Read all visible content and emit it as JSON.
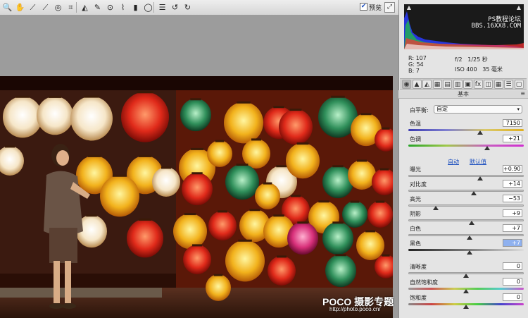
{
  "toolbar": {
    "tools": [
      {
        "name": "zoom-tool-icon",
        "glyph": "🔍"
      },
      {
        "name": "hand-tool-icon",
        "glyph": "✋"
      },
      {
        "name": "white-balance-tool-icon",
        "glyph": "⟋"
      },
      {
        "name": "color-sampler-icon",
        "glyph": "⟋"
      },
      {
        "name": "targeted-adjust-icon",
        "glyph": "◎"
      },
      {
        "name": "crop-tool-icon",
        "glyph": "⌗"
      },
      {
        "name": "straighten-tool-icon",
        "glyph": "◭"
      },
      {
        "name": "spot-removal-icon",
        "glyph": "✎"
      },
      {
        "name": "red-eye-icon",
        "glyph": "⊙"
      },
      {
        "name": "adjustment-brush-icon",
        "glyph": "⌇"
      },
      {
        "name": "graduated-filter-icon",
        "glyph": "▮"
      },
      {
        "name": "radial-filter-icon",
        "glyph": "◯"
      },
      {
        "name": "preferences-icon",
        "glyph": "☰"
      },
      {
        "name": "rotate-ccw-icon",
        "glyph": "↺"
      },
      {
        "name": "rotate-cw-icon",
        "glyph": "↻"
      }
    ],
    "preview_checked": "✔",
    "preview_label": "预览",
    "fullscreen_glyph": "⤢"
  },
  "watermark": {
    "brand": "POCO 摄影专题",
    "url": "http://photo.poco.cn/"
  },
  "histogram": {
    "watermark_line1": "PS教程论坛",
    "watermark_line2": "BBS.16XX8.COM"
  },
  "readout": {
    "r_label": "R:",
    "r_value": "107",
    "g_label": "G:",
    "g_value": "54",
    "b_label": "B:",
    "b_value": "7",
    "aperture": "f/2",
    "shutter": "1/25 秒",
    "iso": "ISO 400",
    "focal": "35 毫米"
  },
  "panel_tabs": [
    "◉",
    "▲",
    "◭",
    "▦",
    "▤",
    "▥",
    "▣",
    "fx",
    "◫",
    "▦",
    "☰",
    "▢"
  ],
  "section": {
    "title": "基本",
    "menu_glyph": "≡"
  },
  "white_balance": {
    "label": "白平衡:",
    "value": "自定",
    "chevron": "▾"
  },
  "auto_link": "自动",
  "default_link": "默认值",
  "sliders": {
    "temperature": {
      "label": "色温",
      "value": "7150",
      "level": 0.62
    },
    "tint": {
      "label": "色调",
      "value": "+21",
      "level": 0.68
    },
    "exposure": {
      "label": "曝光",
      "value": "+0.90",
      "level": 0.62
    },
    "contrast": {
      "label": "对比度",
      "value": "+14",
      "level": 0.57
    },
    "highlights": {
      "label": "高光",
      "value": "−53",
      "level": 0.24
    },
    "shadows": {
      "label": "阴影",
      "value": "+9",
      "level": 0.55
    },
    "whites": {
      "label": "白色",
      "value": "+7",
      "level": 0.53
    },
    "blacks": {
      "label": "黑色",
      "value": "+7",
      "level": 0.53
    },
    "clarity": {
      "label": "清晰度",
      "value": "0",
      "level": 0.5
    },
    "vibrance": {
      "label": "自然饱和度",
      "value": "0",
      "level": 0.5
    },
    "saturation": {
      "label": "饱和度",
      "value": "0",
      "level": 0.5
    }
  }
}
